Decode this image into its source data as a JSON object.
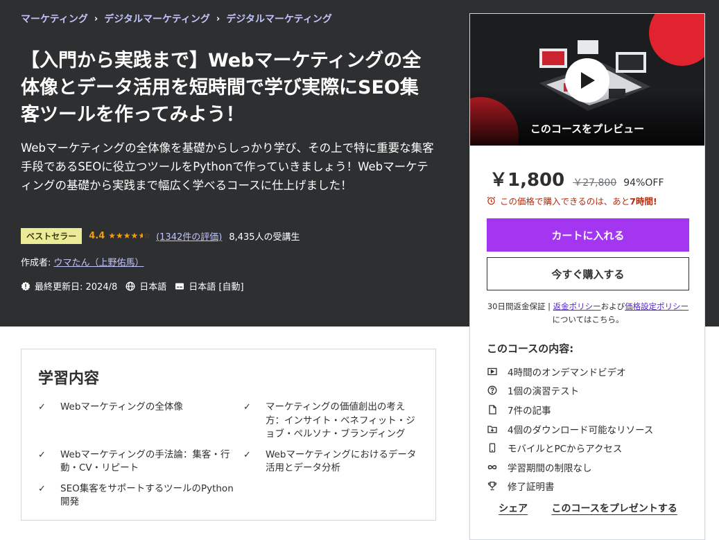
{
  "breadcrumb": [
    "マーケティング",
    "デジタルマーケティング",
    "デジタルマーケティング"
  ],
  "course": {
    "title": "【入門から実践まで】Webマーケティングの全体像とデータ活用を短時間で学び実際にSEO集客ツールを作ってみよう！",
    "subtitle": "Webマーケティングの全体像を基礎からしっかり学び、その上で特に重要な集客手段であるSEOに役立つツールをPythonで作っていきましょう！Webマーケティングの基礎から実践まで幅広く学べるコースに仕上げました！",
    "badge": "ベストセラー",
    "rating": "4.4",
    "rating_value": 4.4,
    "reviews": "(1342件の評価)",
    "students": "8,435人の受講生",
    "author_label": "作成者:",
    "author": "ウマたん（上野佑馬）",
    "updated": "最終更新日: 2024/8",
    "language": "日本語",
    "captions": "日本語 [自動]"
  },
  "card": {
    "preview_label": "このコースをプレビュー",
    "price": "￥1,800",
    "original_price": "￥27,800",
    "discount": "94%OFF",
    "timer_text": "この価格で購入できるのは、あと",
    "timer_value": "7時間!",
    "add_to_cart": "カートに入れる",
    "buy_now": "今すぐ購入する",
    "guarantee_prefix": "30日間返金保証 | ",
    "refund_policy": "返金ポリシー",
    "guarantee_and": "および",
    "pricing_policy": "価格設定ポリシー",
    "guarantee_suffix": "についてはこちら。",
    "includes_title": "このコースの内容:",
    "includes": [
      {
        "icon": "video-icon",
        "label": "4時間のオンデマンドビデオ"
      },
      {
        "icon": "quiz-icon",
        "label": "1個の演習テスト"
      },
      {
        "icon": "article-icon",
        "label": "7件の記事"
      },
      {
        "icon": "download-icon",
        "label": "4個のダウンロード可能なリソース"
      },
      {
        "icon": "mobile-icon",
        "label": "モバイルとPCからアクセス"
      },
      {
        "icon": "infinity-icon",
        "label": "学習期間の制限なし"
      },
      {
        "icon": "trophy-icon",
        "label": "修了証明書"
      }
    ],
    "share": "シェア",
    "gift": "このコースをプレゼントする"
  },
  "learn": {
    "title": "学習内容",
    "items": [
      "Webマーケティングの全体像",
      "マーケティングの価値創出の考え方：インサイト・ベネフィット・ジョブ・ペルソナ・ブランディング",
      "Webマーケティングの手法論：集客・行動・CV・リピート",
      "Webマーケティングにおけるデータ活用とデータ分析",
      "SEO集客をサポートするツールのPython開発"
    ]
  },
  "colors": {
    "hero_bg": "#2d2f31",
    "accent_purple": "#a435f0",
    "link_lavender": "#c0c4fc",
    "star_orange": "#f69c08",
    "badge_yellow": "#eceb98",
    "timer_red": "#b32d0f"
  }
}
